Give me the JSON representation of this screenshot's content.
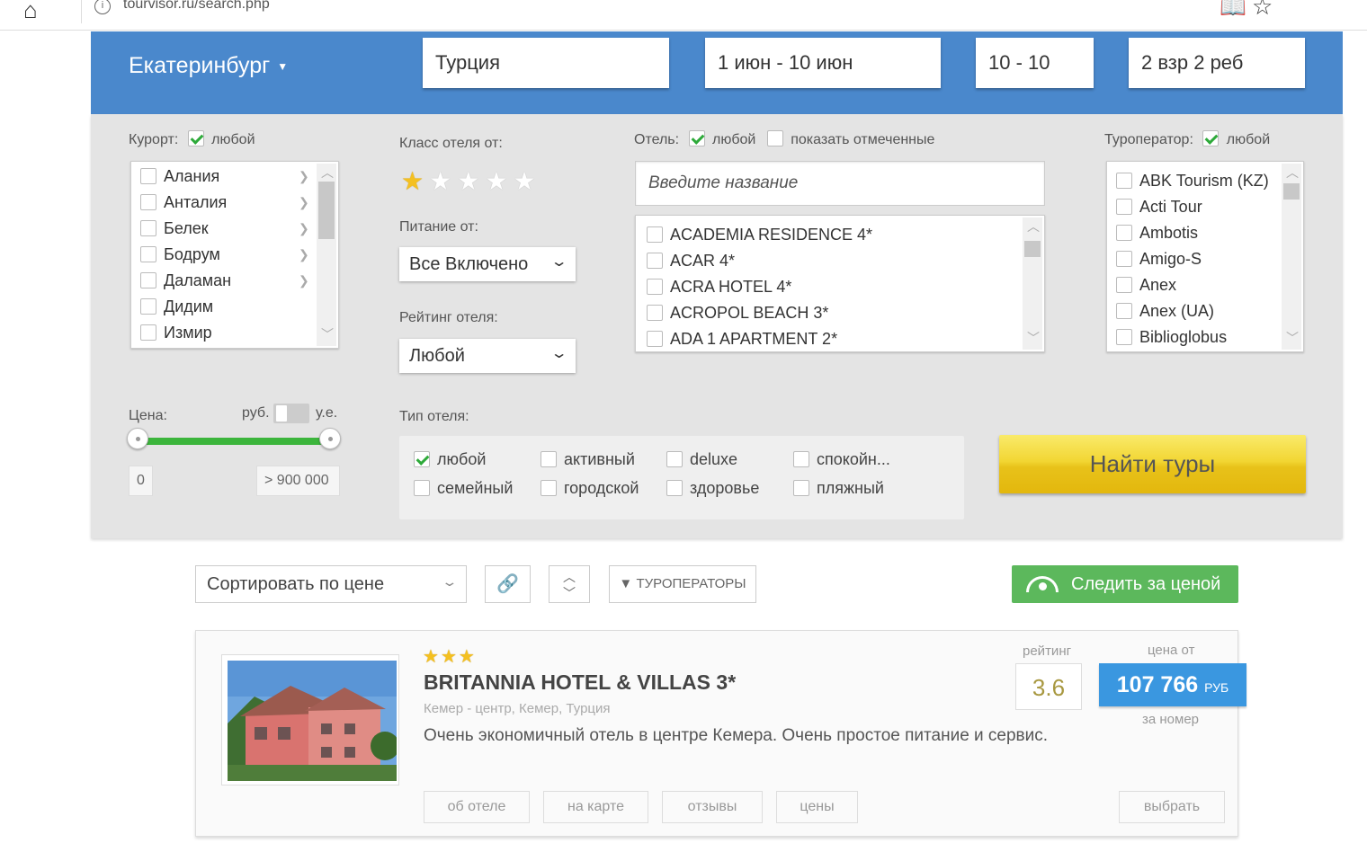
{
  "browser": {
    "url": "tourvisor.ru/search.php"
  },
  "header": {
    "city": "Екатеринбург",
    "country": "Турция",
    "dates": "1 июн - 10 июн",
    "nights": "10 - 10",
    "tourists": "2 взр 2 реб"
  },
  "resort": {
    "label": "Курорт:",
    "any_label": "любой",
    "items": [
      "Алания",
      "Анталия",
      "Белек",
      "Бодрум",
      "Даламан",
      "Дидим",
      "Измир"
    ]
  },
  "hotel_class": {
    "label": "Класс отеля от:",
    "selected": 1,
    "max": 5
  },
  "meal": {
    "label": "Питание от:",
    "value": "Все Включено"
  },
  "rating": {
    "label": "Рейтинг отеля:",
    "value": "Любой"
  },
  "hotel": {
    "label": "Отель:",
    "any_label": "любой",
    "show_marked_label": "показать отмеченные",
    "search_placeholder": "Введите название",
    "items": [
      "ACADEMIA RESIDENCE 4*",
      "ACAR 4*",
      "ACRA HOTEL 4*",
      "ACROPOL BEACH 3*",
      "ADA 1 APARTMENT 2*"
    ]
  },
  "operator": {
    "label": "Туроператор:",
    "any_label": "любой",
    "items": [
      "ABK Tourism (KZ)",
      "Acti Tour",
      "Ambotis",
      "Amigo-S",
      "Anex",
      "Anex (UA)",
      "Biblioglobus"
    ]
  },
  "price": {
    "label": "Цена:",
    "unit_rub": "руб.",
    "unit_ue": "у.е.",
    "min": "0",
    "max": "> 900 000"
  },
  "hotel_type": {
    "label": "Тип отеля:",
    "items": [
      {
        "label": "любой",
        "checked": true
      },
      {
        "label": "активный",
        "checked": false
      },
      {
        "label": "deluxe",
        "checked": false
      },
      {
        "label": "спокойн...",
        "checked": false
      },
      {
        "label": "семейный",
        "checked": false
      },
      {
        "label": "городской",
        "checked": false
      },
      {
        "label": "здоровье",
        "checked": false
      },
      {
        "label": "пляжный",
        "checked": false
      }
    ]
  },
  "search_button": "Найти туры",
  "toolbar": {
    "sort": "Сортировать по цене",
    "operators": "ТУРОПЕРАТОРЫ",
    "watch": "Следить за ценой"
  },
  "result": {
    "stars": 3,
    "name": "BRITANNIA HOTEL & VILLAS 3*",
    "location": "Кемер - центр, Кемер, Турция",
    "description": "Очень экономичный отель в центре Кемера. Очень простое питание и сервис.",
    "rating_label": "рейтинг",
    "rating": "3.6",
    "price_label": "цена от",
    "price": "107 766",
    "currency": "РУБ",
    "per_label": "за номер",
    "buttons": [
      "об отеле",
      "на карте",
      "отзывы",
      "цены"
    ],
    "select": "выбрать"
  },
  "colors": {
    "header": "#4a88cc",
    "find": "#f2d633",
    "green": "#5cb85c",
    "price": "#3a97e0"
  }
}
